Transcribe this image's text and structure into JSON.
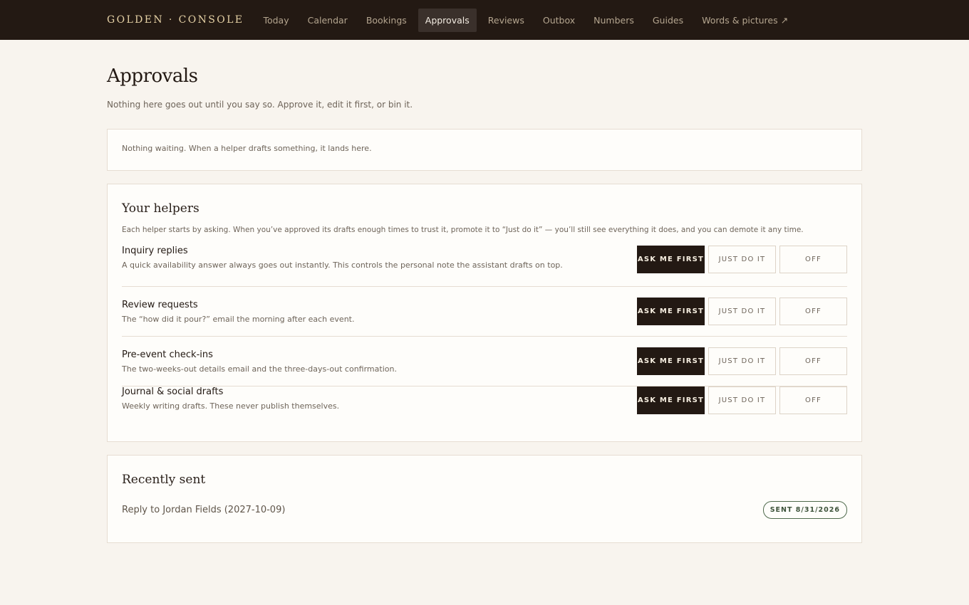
{
  "brand": "GOLDEN · CONSOLE",
  "nav": [
    {
      "label": "Today"
    },
    {
      "label": "Calendar"
    },
    {
      "label": "Bookings"
    },
    {
      "label": "Approvals",
      "active": true
    },
    {
      "label": "Reviews"
    },
    {
      "label": "Outbox"
    },
    {
      "label": "Numbers"
    },
    {
      "label": "Guides"
    },
    {
      "label": "Words & pictures ↗"
    }
  ],
  "page": {
    "title": "Approvals",
    "subtitle": "Nothing here goes out until you say so. Approve it, edit it first, or bin it."
  },
  "queue": {
    "empty_text": "Nothing waiting. When a helper drafts something, it lands here."
  },
  "helpers": {
    "title": "Your helpers",
    "description": "Each helper starts by asking. When you’ve approved its drafts enough times to trust it, promote it to “Just do it” — you’ll still see everything it does, and you can demote it any time.",
    "mode_labels": [
      "ASK ME FIRST",
      "JUST DO IT",
      "OFF"
    ],
    "items": [
      {
        "title": "Inquiry replies",
        "desc": "A quick availability answer always goes out instantly. This controls the personal note the assistant drafts on top.",
        "mode": "ASK ME FIRST"
      },
      {
        "title": "Review requests",
        "desc": "The “how did it pour?” email the morning after each event.",
        "mode": "ASK ME FIRST"
      },
      {
        "title": "Pre-event check-ins",
        "desc": "The two-weeks-out details email and the three-days-out confirmation.",
        "mode": "ASK ME FIRST"
      },
      {
        "title": "Journal & social drafts",
        "desc": "Weekly writing drafts. These never publish themselves.",
        "mode": "ASK ME FIRST"
      }
    ]
  },
  "recent": {
    "title": "Recently sent",
    "items": [
      {
        "text": "Reply to Jordan Fields (2027-10-09)",
        "badge": "SENT 8/31/2026"
      }
    ]
  },
  "colors": {
    "topbar": "#231913",
    "brand": "#e6d2a6",
    "background": "#f8f4ee",
    "selected_button": "#231913",
    "sent_badge": "#4f6a4c"
  }
}
